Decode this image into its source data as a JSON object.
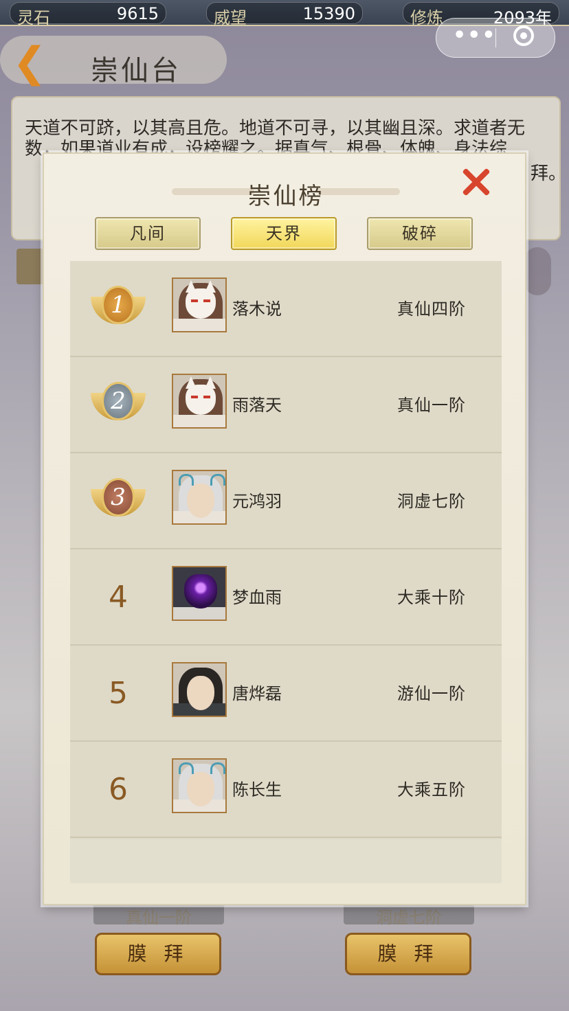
{
  "resources": [
    {
      "label": "灵石",
      "value": "9615"
    },
    {
      "label": "威望",
      "value": "15390"
    },
    {
      "label": "修炼",
      "value": "2093年"
    }
  ],
  "header": {
    "title": "崇仙台"
  },
  "description": "天道不可跻，以其高且危。地道不可寻，以其幽且深。求道者无数，如果道业有成，设榜耀之。据真气、根骨、体魄、身法综",
  "description_tail": "拜。",
  "background": {
    "ranks": [
      "真仙一阶",
      "洞虚七阶"
    ],
    "worship_label": "膜 拜"
  },
  "modal": {
    "title": "崇仙榜",
    "tabs": [
      {
        "label": "凡间",
        "active": false
      },
      {
        "label": "天界",
        "active": true
      },
      {
        "label": "破碎",
        "active": false
      }
    ],
    "rows": [
      {
        "rank": "1",
        "name": "落木说",
        "realm": "真仙四阶",
        "medal": "gold",
        "avatar": "fox-mask"
      },
      {
        "rank": "2",
        "name": "雨落天",
        "realm": "真仙一阶",
        "medal": "silver",
        "avatar": "fox-mask"
      },
      {
        "rank": "3",
        "name": "元鸿羽",
        "realm": "洞虚七阶",
        "medal": "bronze",
        "avatar": "dragon-horns"
      },
      {
        "rank": "4",
        "name": "梦血雨",
        "realm": "大乘十阶",
        "medal": null,
        "avatar": "demon-mask"
      },
      {
        "rank": "5",
        "name": "唐烨磊",
        "realm": "游仙一阶",
        "medal": null,
        "avatar": "black-hair"
      },
      {
        "rank": "6",
        "name": "陈长生",
        "realm": "大乘五阶",
        "medal": null,
        "avatar": "dragon-horns"
      }
    ]
  },
  "colors": {
    "accent_close": "#d8452d",
    "tab_active": "#f1d75a",
    "medal_gold": "#c98a2a",
    "medal_silver": "#7e8a93",
    "medal_bronze": "#9a5a44"
  }
}
